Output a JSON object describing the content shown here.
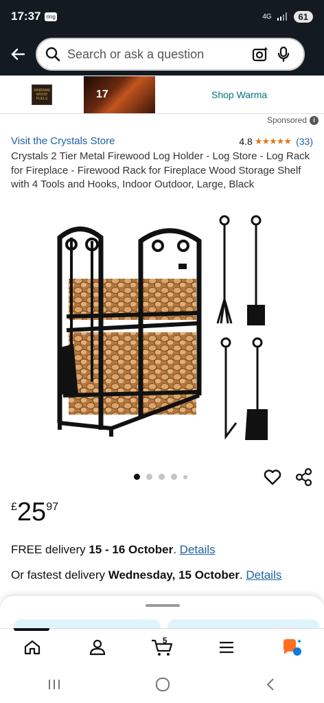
{
  "status": {
    "time": "17:37",
    "ring_badge": "ring",
    "network": "4G",
    "battery": "61"
  },
  "search": {
    "placeholder": "Search or ask a question"
  },
  "banner": {
    "logo_text": "KINDRAM WOOD FUELS",
    "image_text": "17",
    "link": "Shop Warma"
  },
  "sponsored": "Sponsored",
  "product": {
    "store_link": "Visit the Crystals Store",
    "rating_value": "4.8",
    "stars": "★★★★★",
    "rating_count": "(33)",
    "title": "Crystals 2 Tier Metal Firewood Log Holder - Log Store - Log Rack for Fireplace - Firewood Rack for Fireplace Wood Storage Shelf with 4 Tools and Hooks, Indoor Outdoor, Large, Black",
    "image_count": 5,
    "active_image": 1
  },
  "price": {
    "currency": "£",
    "whole": "25",
    "fraction": "97"
  },
  "delivery": {
    "free_prefix": "FREE delivery ",
    "free_dates": "15 - 16 October",
    "free_suffix": ". ",
    "fast_prefix": "Or fastest delivery ",
    "fast_date": "Wednesday, 15 October",
    "fast_suffix": ". ",
    "details_link": "Details"
  },
  "nav": {
    "cart_count": "5",
    "items": [
      "home-icon",
      "account-icon",
      "cart-icon",
      "menu-icon",
      "rufus-icon"
    ]
  },
  "colors": {
    "header_bg": "#131a22",
    "link": "#2162a1",
    "star": "#de7921",
    "rufus_orange": "#ff6f20",
    "rufus_blue": "#0b7bdc"
  }
}
